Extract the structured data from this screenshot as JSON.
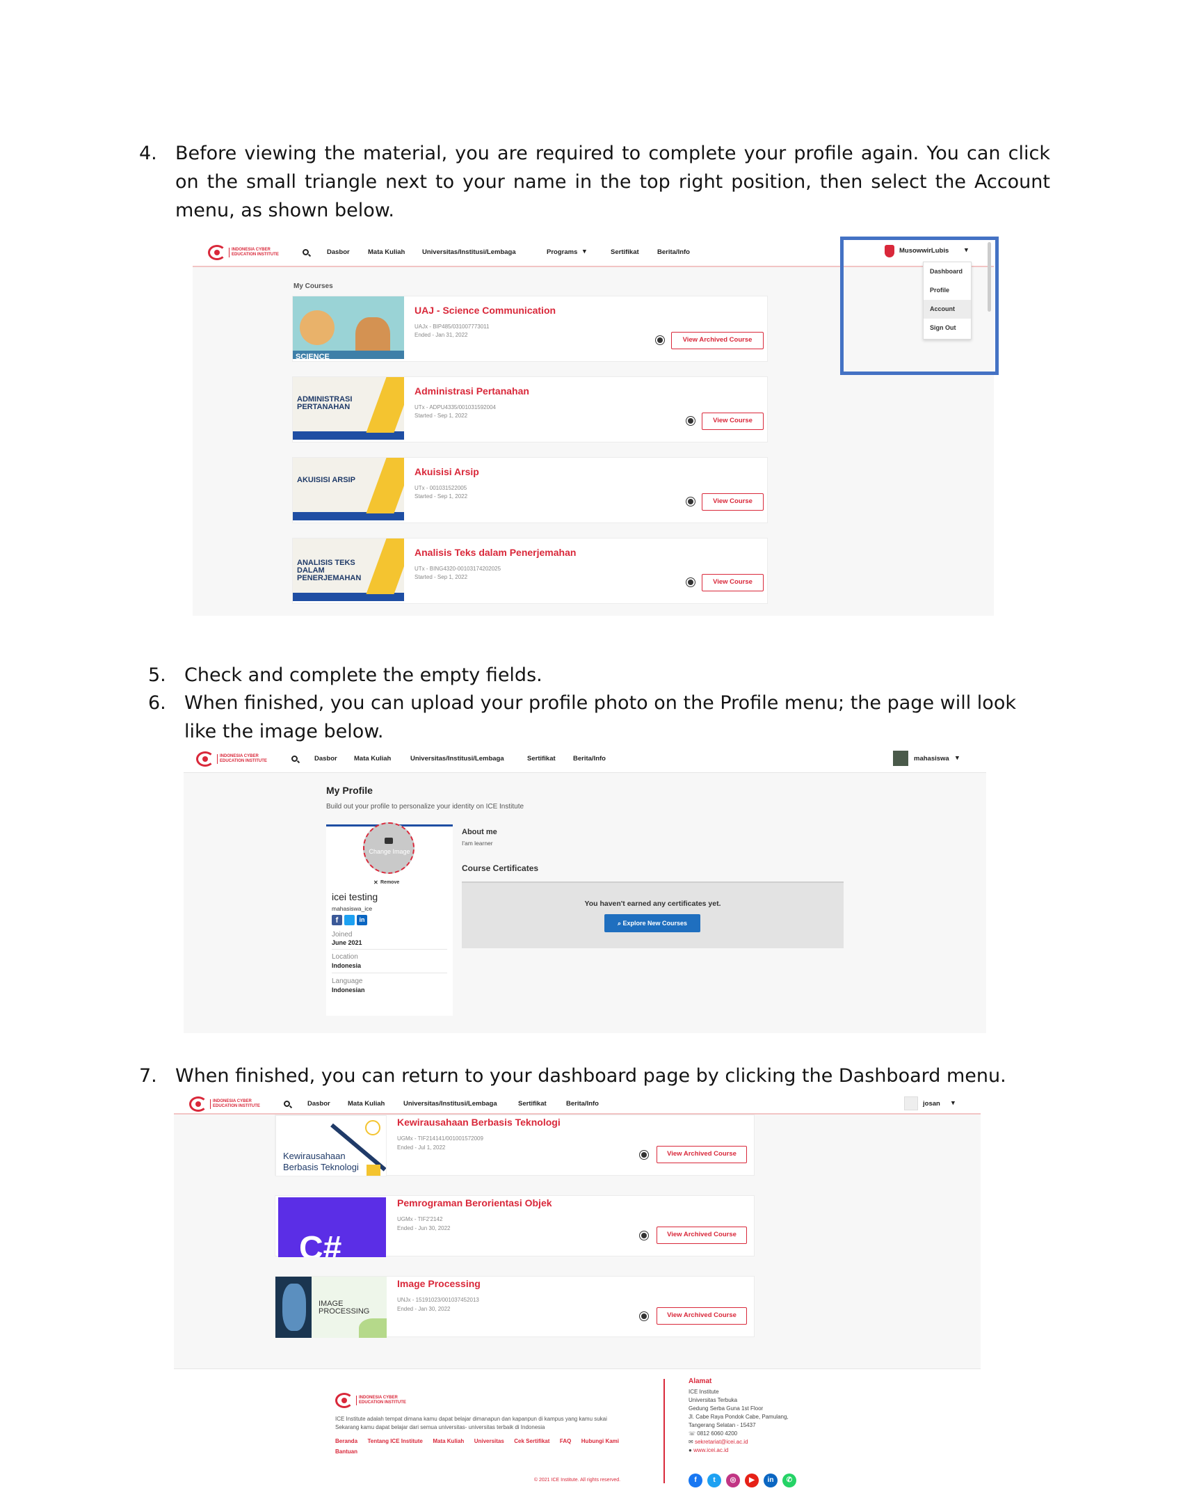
{
  "steps": {
    "s4": {
      "num": "4.",
      "text": "Before viewing the material, you are required to complete your profile again. You can click on the small triangle next to your name in the top right position, then select the Account menu, as shown below."
    },
    "s5": {
      "num": "5.",
      "text": "Check and complete the empty fields."
    },
    "s6": {
      "num": "6.",
      "text": "When finished, you can upload your profile photo on the Profile menu; the page will look like the image below."
    },
    "s7": {
      "num": "7.",
      "text": "When finished, you can return to your dashboard page by clicking the Dashboard menu."
    }
  },
  "brand": {
    "logo_text": "INDONESIA CYBER EDUCATION INSTITUTE",
    "accent": "#d9283a",
    "highlight": "#4472c4"
  },
  "shot1": {
    "nav": [
      "Dasbor",
      "Mata Kuliah",
      "Universitas/Institusi/Lembaga",
      "Programs",
      "Sertifikat",
      "Berita/Info"
    ],
    "user": "MusowwirLubis",
    "menu": [
      "Dashboard",
      "Profile",
      "Account",
      "Sign Out"
    ],
    "section": "My Courses",
    "courses": [
      {
        "title": "UAJ - Science Communication",
        "code": "UAJx - BIP485/031007773011",
        "date": "Ended - Jan 31, 2022",
        "button": "View Archived Course",
        "thumb": "SCIENCE"
      },
      {
        "title": "Administrasi Pertanahan",
        "code": "UTx - ADPU4335/001031592004",
        "date": "Started - Sep 1, 2022",
        "button": "View Course",
        "thumb": "ADMINISTRASI PERTANAHAN"
      },
      {
        "title": "Akuisisi Arsip",
        "code": "UTx - 001031522005",
        "date": "Started - Sep 1, 2022",
        "button": "View Course",
        "thumb": "AKUISISI ARSIP"
      },
      {
        "title": "Analisis Teks dalam Penerjemahan",
        "code": "UTx - BING4320-00103174202025",
        "date": "Started - Sep 1, 2022",
        "button": "View Course",
        "thumb": "ANALISIS TEKS DALAM PENERJEMAHAN"
      }
    ]
  },
  "shot2": {
    "nav": [
      "Dasbor",
      "Mata Kuliah",
      "Universitas/Institusi/Lembaga",
      "Sertifikat",
      "Berita/Info"
    ],
    "user": "mahasiswa",
    "title": "My Profile",
    "subtitle": "Build out your profile to personalize your identity on ICE Institute",
    "change_image": "Change Image",
    "remove": "Remove",
    "name": "icei testing",
    "username": "mahasiswa_ice",
    "joined_label": "Joined",
    "joined": "June 2021",
    "location_label": "Location",
    "location": "Indonesia",
    "language_label": "Language",
    "language": "Indonesian",
    "about_heading": "About me",
    "about_text": "I'am learner",
    "cert_heading": "Course Certificates",
    "cert_empty": "You haven't earned any certificates yet.",
    "explore": "Explore New Courses"
  },
  "shot3": {
    "nav": [
      "Dasbor",
      "Mata Kuliah",
      "Universitas/Institusi/Lembaga",
      "Sertifikat",
      "Berita/Info"
    ],
    "user": "josan",
    "courses": [
      {
        "title": "Kewirausahaan Berbasis Teknologi",
        "code": "UGMx - TIF214141/001001572009",
        "date": "Ended - Jul 1, 2022",
        "button": "View Archived Course",
        "thumb": "Kewirausahaan Berbasis Teknologi"
      },
      {
        "title": "Pemrograman Berorientasi Objek",
        "code": "UGMx - TIF2'2142",
        "date": "Ended - Jun 30, 2022",
        "button": "View Archived Course",
        "thumb": "C#"
      },
      {
        "title": "Image Processing",
        "code": "UNJx - 15191023/001037452013",
        "date": "Ended - Jan 30, 2022",
        "button": "View Archived Course",
        "thumb": "IMAGE PROCESSING"
      }
    ],
    "footer": {
      "desc1": "ICE Institute adalah tempat dimana kamu dapat belajar dimanapun dan kapanpun di kampus yang kamu sukai",
      "desc2": "Sekarang kamu dapat belajar dari semua universitas- universitas terbaik di Indonesia",
      "links": [
        "Beranda",
        "Tentang ICE Institute",
        "Mata Kuliah",
        "Universitas",
        "Cek Sertifikat",
        "FAQ",
        "Hubungi Kami",
        "Bantuan"
      ],
      "address_heading": "Alamat",
      "address": [
        "ICE Institute",
        "Universitas Terbuka",
        "Gedung Serba Guna 1st Floor",
        "Jl. Cabe Raya Pondok Cabe, Pamulang,",
        "Tangerang Selatan - 15437"
      ],
      "phone": "0812 6060 4200",
      "email": "sekretariat@icei.ac.id",
      "web": "www.icei.ac.id",
      "copyright": "© 2021 ICE Institute. All rights reserved."
    }
  }
}
